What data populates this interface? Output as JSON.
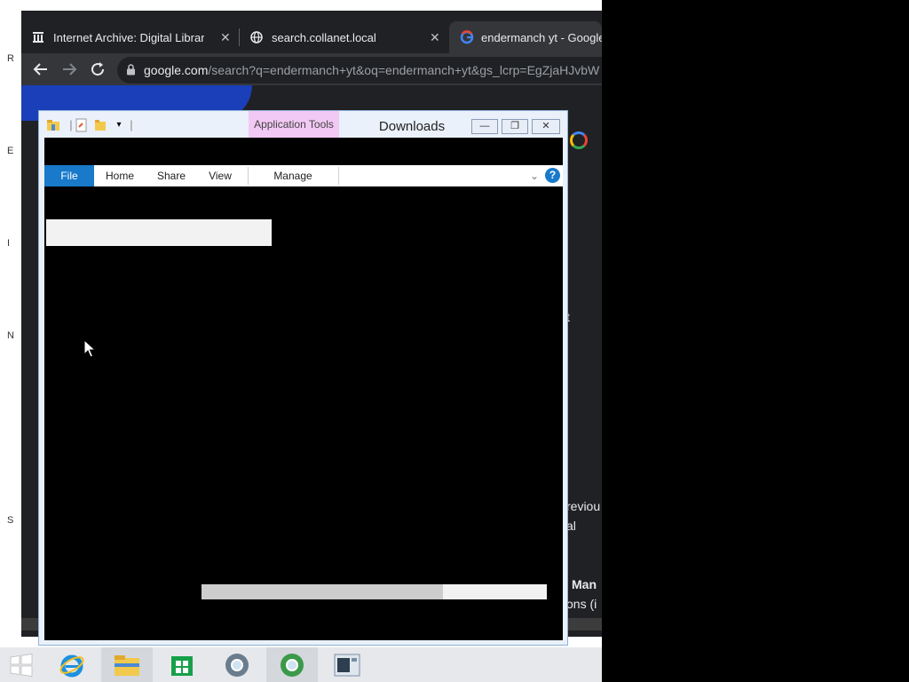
{
  "desktop": {
    "edge_letters": [
      "R",
      "E",
      "I",
      "N",
      "S"
    ]
  },
  "browser": {
    "tabs": [
      {
        "title": "Internet Archive: Digital Library",
        "icon": "archive-icon",
        "close": "✕"
      },
      {
        "title": "search.collanet.local",
        "icon": "globe-icon",
        "close": "✕"
      },
      {
        "title": "endermanch yt - Google S",
        "icon": "google-icon",
        "active": true
      }
    ],
    "address": {
      "host": "google.com",
      "rest": "/search?q=endermanch+yt&oq=endermanch+yt&gs_lcrp=EgZjaHJvbW"
    },
    "page_fragments": [
      "t",
      "reviou",
      "al",
      "Man",
      "ons (i"
    ]
  },
  "explorer": {
    "contextual_tab": "Application Tools",
    "title": "Downloads",
    "caption_buttons": {
      "minimize": "—",
      "restore": "❐",
      "close": "✕"
    },
    "ribbon_tabs": [
      "File",
      "Home",
      "Share",
      "View",
      "Manage"
    ],
    "help": "?",
    "progress_fraction": 0.7
  },
  "taskbar": {
    "items": [
      "start-icon",
      "internet-explorer-icon",
      "file-explorer-icon",
      "store-icon",
      "chrome-icon",
      "chrome-icon",
      "application-icon"
    ]
  }
}
